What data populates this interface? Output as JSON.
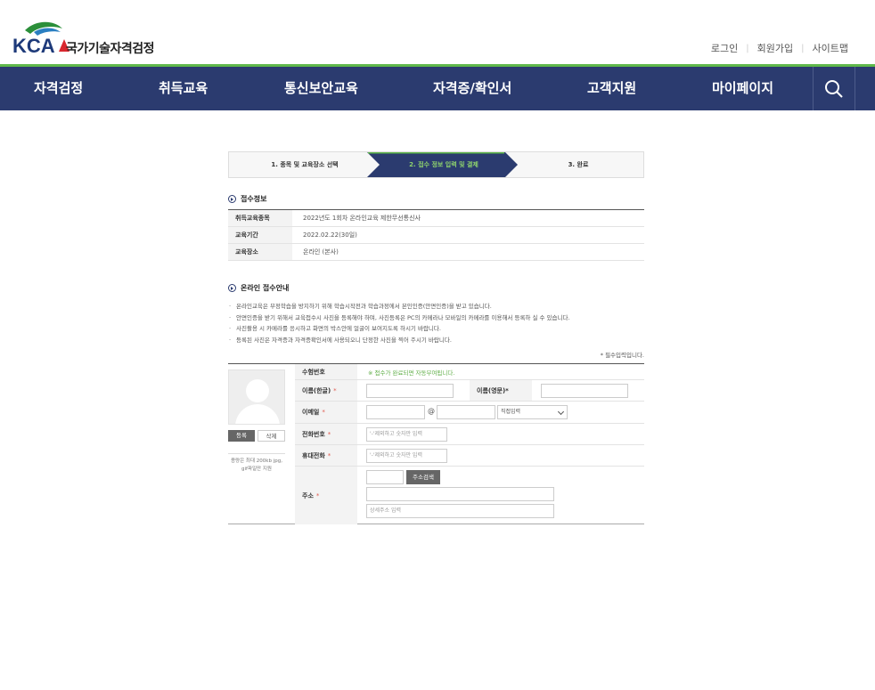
{
  "header": {
    "logo_text": "KCA",
    "org_name": "국가기술자격검정",
    "util_links": [
      "로그인",
      "회원가입",
      "사이트맵"
    ]
  },
  "gnb": {
    "items": [
      "자격검정",
      "취득교육",
      "통신보안교육",
      "자격증/확인서",
      "고객지원",
      "마이페이지"
    ],
    "search_icon": "search-icon"
  },
  "steps": [
    {
      "label": "1. 종목 및 교육장소 선택",
      "active": false
    },
    {
      "label": "2. 접수 정보 입력 및 결제",
      "active": true
    },
    {
      "label": "3. 완료",
      "active": false
    }
  ],
  "receipt": {
    "title": "접수정보",
    "rows": [
      {
        "label": "취득교육종목",
        "value": "2022년도 1회차 온라인교육 제한무선통신사"
      },
      {
        "label": "교육기간",
        "value": "2022.02.22(30일)"
      },
      {
        "label": "교육장소",
        "value": "온라인 (본사)"
      }
    ]
  },
  "guide": {
    "title": "온라인 접수안내",
    "items": [
      "온라인교육은 부정학습을 방지하기 위해 학습시작전과 학습과정에서 본인인증(안면인증)을 받고 있습니다.",
      "안면인증을 받기 위해서 교육접수시 사진을 등록해야 하며, 사진등록은 PC의 카메라나 모바일의 카메라를 이용해서 등록하 실 수 있습니다.",
      "사진촬용 시 카메라를 응시하고 화면의 박스안에 얼굴이 보여지도록 하시기 바랍니다.",
      "등록된 사진은 자격증과 자격증확인서에 사용되오니 단정한 사진을 찍어 주시기 바랍니다."
    ]
  },
  "form": {
    "required_note": "* 필수입력입니다.",
    "photo": {
      "register": "등록",
      "delete": "삭제",
      "note": "용량은 최대 200kb jpg, gif파일만 지원"
    },
    "exam_number": {
      "label": "수험번호",
      "hint": "※ 접수가 완료되면 자동부여됩니다."
    },
    "name_kor": {
      "label": "이름(한글)"
    },
    "name_eng": {
      "label": "이름(영문)"
    },
    "email": {
      "label": "이메일",
      "at": "@",
      "domain_select": "직접입력"
    },
    "phone": {
      "label": "전화번호",
      "placeholder": "'-'제외하고 숫자만 입력"
    },
    "mobile": {
      "label": "휴대전화",
      "placeholder": "'-'제외하고 숫자만 입력"
    },
    "address": {
      "label": "주소",
      "search_button": "주소검색",
      "detail_placeholder": "상세주소 입력"
    },
    "star": "*"
  }
}
